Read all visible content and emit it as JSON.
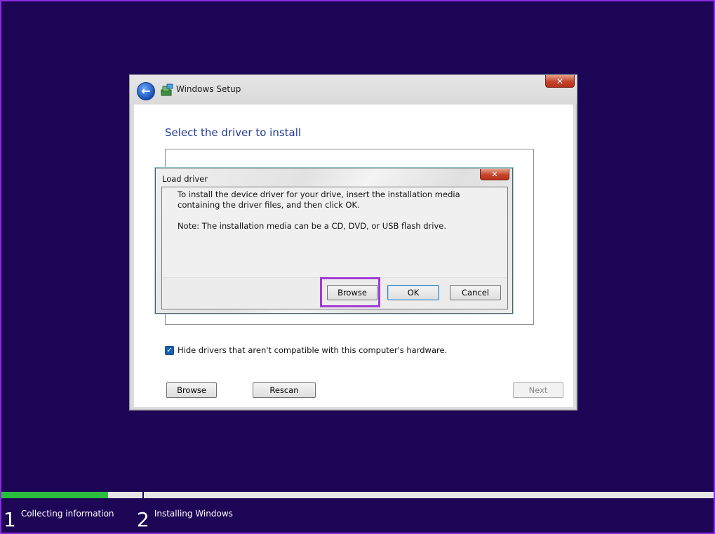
{
  "window": {
    "title": "Windows Setup",
    "close_glyph": "✕",
    "back_glyph": "←",
    "page_title": "Select the driver to install",
    "hide_drivers_label": "Hide drivers that aren't compatible with this computer's hardware.",
    "hide_drivers_checked": true,
    "check_glyph": "✓",
    "buttons": {
      "browse": "Browse",
      "rescan": "Rescan",
      "next": "Next"
    }
  },
  "dialog": {
    "title": "Load driver",
    "close_glyph": "✕",
    "message": "To install the device driver for your drive, insert the installation media containing the driver files, and then click OK.",
    "note": "Note: The installation media can be a CD, DVD, or USB flash drive.",
    "buttons": {
      "browse": "Browse",
      "ok": "OK",
      "cancel": "Cancel"
    }
  },
  "progress": {
    "fraction": 0.15,
    "steps": [
      {
        "number": "1",
        "label": "Collecting information"
      },
      {
        "number": "2",
        "label": "Installing Windows"
      }
    ]
  },
  "colors": {
    "background": "#1e0657",
    "progress_fill": "#2bbd3e",
    "highlight": "#a23bd6",
    "title_blue": "#1f3a93"
  },
  "icons": {
    "back": "back-arrow-icon",
    "app": "windows-setup-icon",
    "close": "close-icon",
    "check": "checkmark-icon"
  }
}
